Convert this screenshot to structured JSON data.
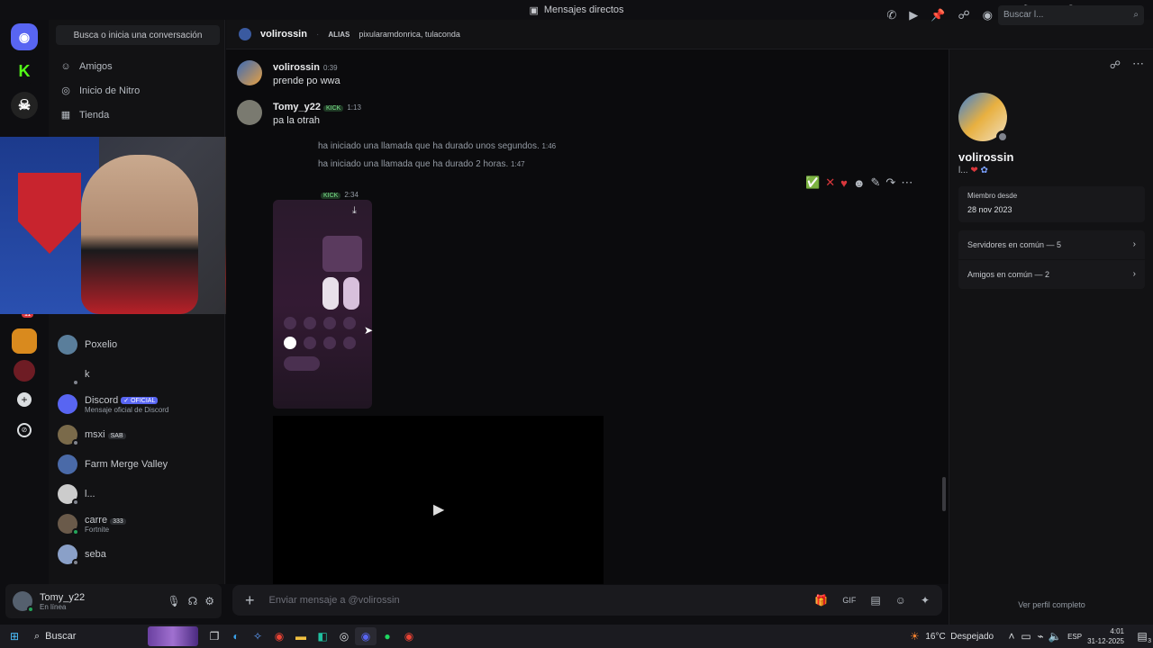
{
  "titlebar": {
    "title": "Mensajes directos"
  },
  "sidebar": {
    "search_placeholder": "Busca o inicia una conversación",
    "nav": [
      {
        "label": "Amigos"
      },
      {
        "label": "Inicio de Nitro"
      },
      {
        "label": "Tienda"
      }
    ],
    "dms": [
      {
        "name": "Poxelio"
      },
      {
        "name": "k"
      },
      {
        "name": "Discord",
        "badge": "✓ OFICIAL",
        "sub": "Mensaje oficial de Discord"
      },
      {
        "name": "msxi",
        "tag": "SAB"
      },
      {
        "name": "Farm Merge Valley"
      },
      {
        "name": "l..."
      },
      {
        "name": "carre",
        "tag": "333",
        "sub": "Fortnite"
      },
      {
        "name": "seba"
      }
    ]
  },
  "user": {
    "name": "Tomy_y22",
    "status": "En línea"
  },
  "header": {
    "username": "volirossin",
    "alias_label": "ALIAS",
    "alias_value": "pixularamdonrica, tulaconda",
    "search_placeholder": "Buscar l..."
  },
  "messages": [
    {
      "user": "volirossin",
      "time": "0:39",
      "text": "prende po wwa"
    },
    {
      "user": "Tomy_y22",
      "tag": "KICK",
      "time": "1:13",
      "text": "pa la otrah"
    }
  ],
  "system": [
    {
      "text": "ha iniciado una llamada que ha durado unos segundos.",
      "time": "1:46"
    },
    {
      "text": "ha iniciado una llamada que ha durado 2 horas.",
      "time": "1:47"
    }
  ],
  "third_msg": {
    "tag": "KICK",
    "time": "2:34"
  },
  "composer": {
    "placeholder": "Enviar mensaje a @volirossin"
  },
  "profile": {
    "username": "volirossin",
    "short": "l...",
    "member_label": "Miembro desde",
    "member_date": "28 nov 2023",
    "servers": "Servidores en común — 5",
    "friends": "Amigos en común — 2",
    "full_profile": "Ver perfil completo"
  },
  "taskbar": {
    "search": "Buscar",
    "weather_temp": "16°C",
    "weather_text": "Despejado",
    "lang": "ESP",
    "time": "4:01",
    "date": "31-12-2025",
    "notif_count": "3"
  },
  "rail_badge": "11",
  "colors": {
    "blurple": "#5865f2",
    "green": "#23a55a",
    "bg": "#0b0b0d"
  }
}
